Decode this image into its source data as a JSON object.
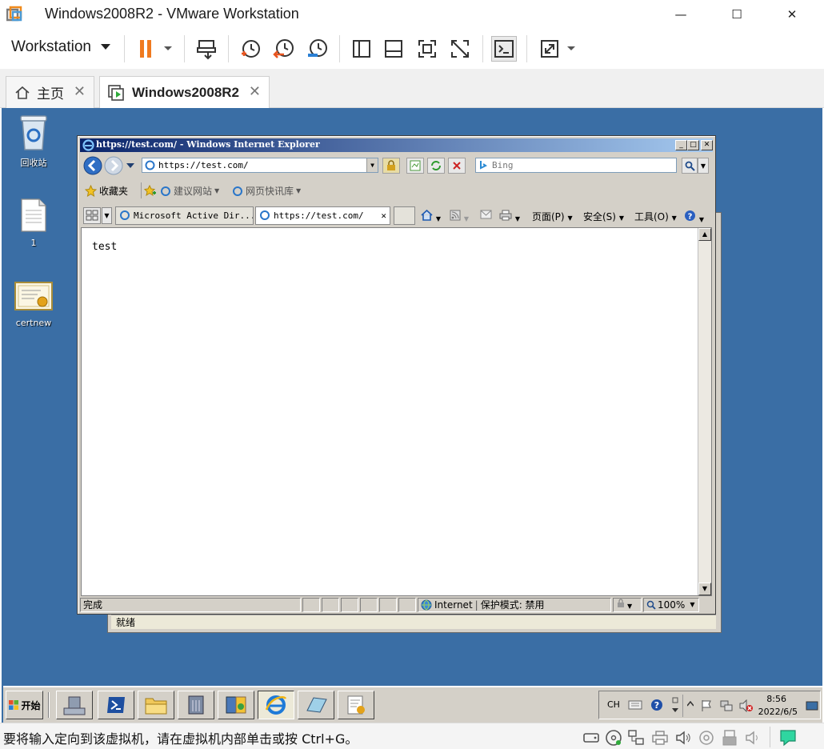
{
  "app": {
    "title": "Windows2008R2 - VMware Workstation",
    "menu_label": "Workstation",
    "window_controls": {
      "minimize": "—",
      "maximize": "☐",
      "close": "✕"
    }
  },
  "toolbar": {
    "icons": [
      "pause-icon",
      "send-ctrl-alt-del-icon",
      "snapshot-take-icon",
      "snapshot-revert-icon",
      "snapshot-manager-icon",
      "sidebar-toggle-icon",
      "thumbnail-bar-icon",
      "fullscreen-icon",
      "unity-icon",
      "console-icon",
      "stretch-icon"
    ]
  },
  "tabs": [
    {
      "label": "主页",
      "icon": "home-icon",
      "close": "✕"
    },
    {
      "label": "Windows2008R2",
      "icon": "vm-icon",
      "close": "✕",
      "active": true
    }
  ],
  "desktop": {
    "icons": [
      {
        "label": "回收站",
        "icon": "recycle-bin-icon"
      },
      {
        "label": "1",
        "icon": "text-file-icon"
      },
      {
        "label": "certnew",
        "icon": "certificate-icon"
      }
    ],
    "background_color": "#3a6ea5"
  },
  "ghost_window": {
    "status_text": "就绪"
  },
  "ie": {
    "title": "https://test.com/ - Windows Internet Explorer",
    "address": "https://test.com/",
    "search_placeholder": "Bing",
    "favorites": {
      "label": "收藏夹",
      "suggested_sites": "建议网站",
      "web_slice": "网页快讯库"
    },
    "tabs": [
      {
        "label": "Microsoft Active Dir..."
      },
      {
        "label": "https://test.com/",
        "active": true,
        "close": "✕"
      }
    ],
    "commands": {
      "page": "页面(P)",
      "safety": "安全(S)",
      "tools": "工具(O)"
    },
    "page_text": "test",
    "status": {
      "left": "完成",
      "zone": "Internet",
      "protected_mode": "保护模式: 禁用",
      "zoom": "100%"
    }
  },
  "taskbar": {
    "start_label": "开始",
    "items": [
      "server-manager-icon",
      "powershell-icon",
      "explorer-icon",
      "admin-tools-icon",
      "certsrv-icon",
      "ie-icon",
      "notepad-icon",
      "certificate-mmc-icon"
    ],
    "tray": {
      "lang": "CH",
      "time": "8:56",
      "date": "2022/6/5"
    }
  },
  "statusbar": {
    "message": "要将输入定向到该虚拟机，请在虚拟机内部单击或按 Ctrl+G。"
  }
}
